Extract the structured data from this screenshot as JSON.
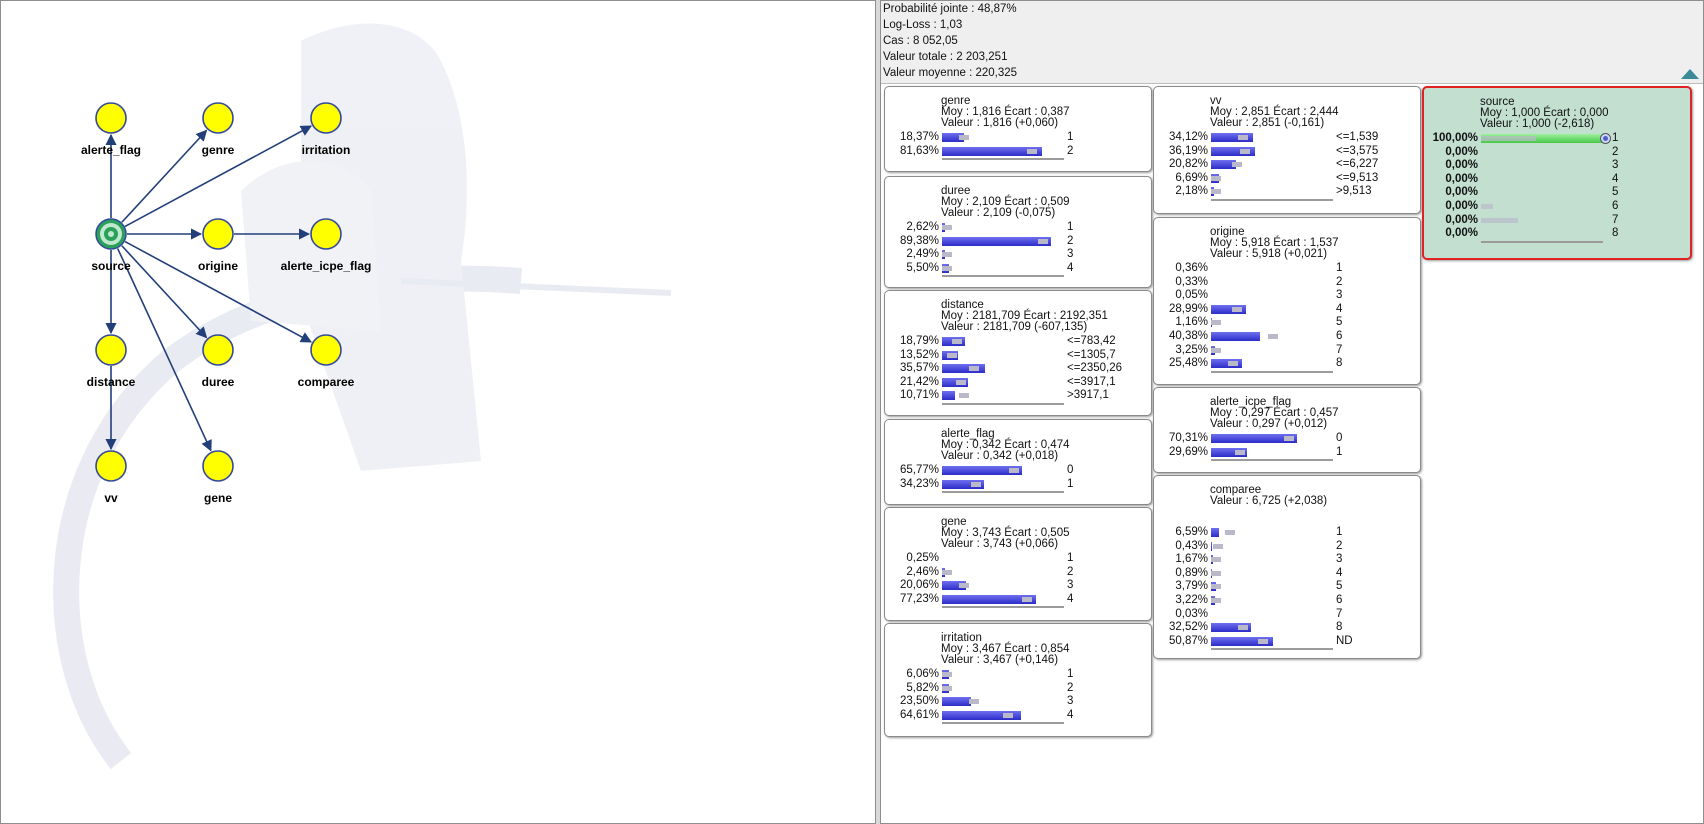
{
  "graph": {
    "nodes": [
      {
        "id": "alerte_flag",
        "label": "alerte_flag"
      },
      {
        "id": "genre",
        "label": "genre"
      },
      {
        "id": "irritation",
        "label": "irritation"
      },
      {
        "id": "source",
        "label": "source"
      },
      {
        "id": "origine",
        "label": "origine"
      },
      {
        "id": "alerte_icpe_flag",
        "label": "alerte_icpe_flag"
      },
      {
        "id": "distance",
        "label": "distance"
      },
      {
        "id": "duree",
        "label": "duree"
      },
      {
        "id": "comparee",
        "label": "comparee"
      },
      {
        "id": "vv",
        "label": "vv"
      },
      {
        "id": "gene",
        "label": "gene"
      }
    ],
    "edges": [
      [
        "source",
        "alerte_flag"
      ],
      [
        "source",
        "genre"
      ],
      [
        "source",
        "irritation"
      ],
      [
        "source",
        "origine"
      ],
      [
        "origine",
        "alerte_icpe_flag"
      ],
      [
        "source",
        "distance"
      ],
      [
        "source",
        "duree"
      ],
      [
        "source",
        "comparee"
      ],
      [
        "distance",
        "vv"
      ],
      [
        "source",
        "gene"
      ]
    ],
    "colors": {
      "node_fill": "#ffff00",
      "node_stroke": "#334a9a",
      "target_fill": "#2aa05a",
      "edge": "#223f7a"
    }
  },
  "stats": {
    "joint": "Probabilité jointe : 48,87%",
    "logloss": "Log-Loss : 1,03",
    "cases": "Cas : 8 052,05",
    "total": "Valeur totale : 2 203,251",
    "mean": "Valeur moyenne : 220,325"
  },
  "cards": [
    {
      "id": "genre",
      "title": "genre",
      "stats": "Moy : 1,816 Écart : 0,387",
      "value": "Valeur : 1,816 (+0,060)",
      "rows": [
        {
          "pct": "18,37%",
          "p": 18.37,
          "label": "1",
          "ghost": 22
        },
        {
          "pct": "81,63%",
          "p": 81.63,
          "label": "2",
          "ghost": 78
        }
      ]
    },
    {
      "id": "duree",
      "title": "duree",
      "stats": "Moy : 2,109 Écart : 0,509",
      "value": "Valeur : 2,109 (-0,075)",
      "rows": [
        {
          "pct": "2,62%",
          "p": 2.62,
          "label": "1",
          "ghost": 3
        },
        {
          "pct": "89,38%",
          "p": 89.38,
          "label": "2",
          "ghost": 87
        },
        {
          "pct": "2,49%",
          "p": 2.49,
          "label": "3",
          "ghost": 3
        },
        {
          "pct": "5,50%",
          "p": 5.5,
          "label": "4",
          "ghost": 7
        }
      ]
    },
    {
      "id": "distance",
      "title": "distance",
      "stats": "Moy : 2181,709 Écart : 2192,351",
      "value": "Valeur : 2181,709 (-607,135)",
      "rows": [
        {
          "pct": "18,79%",
          "p": 18.79,
          "label": "<=783,42",
          "ghost": 16
        },
        {
          "pct": "13,52%",
          "p": 13.52,
          "label": "<=1305,7",
          "ghost": 12
        },
        {
          "pct": "35,57%",
          "p": 35.57,
          "label": "<=2350,26",
          "ghost": 30
        },
        {
          "pct": "21,42%",
          "p": 21.42,
          "label": "<=3917,1",
          "ghost": 20
        },
        {
          "pct": "10,71%",
          "p": 10.71,
          "label": ">3917,1",
          "ghost": 22
        }
      ]
    },
    {
      "id": "alerte_flag",
      "title": "alerte_flag",
      "stats": "Moy : 0,342 Écart : 0,474",
      "value": "Valeur : 0,342 (+0,018)",
      "rows": [
        {
          "pct": "65,77%",
          "p": 65.77,
          "label": "0",
          "ghost": 63
        },
        {
          "pct": "34,23%",
          "p": 34.23,
          "label": "1",
          "ghost": 32
        }
      ]
    },
    {
      "id": "gene",
      "title": "gene",
      "stats": "Moy : 3,743 Écart : 0,505",
      "value": "Valeur : 3,743 (+0,066)",
      "rows": [
        {
          "pct": "0,25%",
          "p": 0.25,
          "label": "1",
          "ghost": 0
        },
        {
          "pct": "2,46%",
          "p": 2.46,
          "label": "2",
          "ghost": 2
        },
        {
          "pct": "20,06%",
          "p": 20.06,
          "label": "3",
          "ghost": 22
        },
        {
          "pct": "77,23%",
          "p": 77.23,
          "label": "4",
          "ghost": 74
        }
      ]
    },
    {
      "id": "irritation",
      "title": "irritation",
      "stats": "Moy : 3,467 Écart : 0,854",
      "value": "Valeur : 3,467 (+0,146)",
      "rows": [
        {
          "pct": "6,06%",
          "p": 6.06,
          "label": "1",
          "ghost": 5
        },
        {
          "pct": "5,82%",
          "p": 5.82,
          "label": "2",
          "ghost": 6
        },
        {
          "pct": "23,50%",
          "p": 23.5,
          "label": "3",
          "ghost": 30
        },
        {
          "pct": "64,61%",
          "p": 64.61,
          "label": "4",
          "ghost": 58
        }
      ]
    },
    {
      "id": "vv",
      "title": "vv",
      "stats": "Moy : 2,851 Écart : 2,444",
      "value": "Valeur : 2,851 (-0,161)",
      "rows": [
        {
          "pct": "34,12%",
          "p": 34.12,
          "label": "<=1,539",
          "ghost": 30
        },
        {
          "pct": "36,19%",
          "p": 36.19,
          "label": "<=3,575",
          "ghost": 32
        },
        {
          "pct": "20,82%",
          "p": 20.82,
          "label": "<=6,227",
          "ghost": 25
        },
        {
          "pct": "6,69%",
          "p": 6.69,
          "label": "<=9,513",
          "ghost": 7
        },
        {
          "pct": "2,18%",
          "p": 2.18,
          "label": ">9,513",
          "ghost": 2
        }
      ]
    },
    {
      "id": "origine",
      "title": "origine",
      "stats": "Moy : 5,918 Écart : 1,537",
      "value": "Valeur : 5,918 (+0,021)",
      "rows": [
        {
          "pct": "0,36%",
          "p": 0.36,
          "label": "1",
          "ghost": 0
        },
        {
          "pct": "0,33%",
          "p": 0.33,
          "label": "2",
          "ghost": 0
        },
        {
          "pct": "0,05%",
          "p": 0.05,
          "label": "3",
          "ghost": 0
        },
        {
          "pct": "28,99%",
          "p": 28.99,
          "label": "4",
          "ghost": 25
        },
        {
          "pct": "1,16%",
          "p": 1.16,
          "label": "5",
          "ghost": 1
        },
        {
          "pct": "40,38%",
          "p": 40.38,
          "label": "6",
          "ghost": 55
        },
        {
          "pct": "3,25%",
          "p": 3.25,
          "label": "7",
          "ghost": 3
        },
        {
          "pct": "25,48%",
          "p": 25.48,
          "label": "8",
          "ghost": 22
        }
      ]
    },
    {
      "id": "alerte_icpe_flag",
      "title": "alerte_icpe_flag",
      "stats": "Moy : 0,297 Écart : 0,457",
      "value": "Valeur : 0,297 (+0,012)",
      "rows": [
        {
          "pct": "70,31%",
          "p": 70.31,
          "label": "0",
          "ghost": 68
        },
        {
          "pct": "29,69%",
          "p": 29.69,
          "label": "1",
          "ghost": 28
        }
      ]
    },
    {
      "id": "comparee",
      "title": "comparee",
      "stats": "",
      "value": "Valeur : 6,725 (+2,038)",
      "rows": [
        {
          "pct": "6,59%",
          "p": 6.59,
          "label": "1",
          "ghost": 20
        },
        {
          "pct": "0,43%",
          "p": 0.43,
          "label": "2",
          "ghost": 10
        },
        {
          "pct": "1,67%",
          "p": 1.67,
          "label": "3",
          "ghost": 4
        },
        {
          "pct": "0,89%",
          "p": 0.89,
          "label": "4",
          "ghost": 2
        },
        {
          "pct": "3,79%",
          "p": 3.79,
          "label": "5",
          "ghost": 3
        },
        {
          "pct": "3,22%",
          "p": 3.22,
          "label": "6",
          "ghost": 3
        },
        {
          "pct": "0,03%",
          "p": 0.03,
          "label": "7",
          "ghost": 0
        },
        {
          "pct": "32,52%",
          "p": 32.52,
          "label": "8",
          "ghost": 30
        },
        {
          "pct": "50,87%",
          "p": 50.87,
          "label": "ND",
          "ghost": 47
        }
      ]
    },
    {
      "id": "source",
      "title": "source",
      "stats": "Moy : 1,000 Écart : 0,000",
      "value": "Valeur : 1,000 (-2,618)",
      "target": true,
      "rows": [
        {
          "pct": "100,00%",
          "p": 100,
          "label": "1",
          "ghost": 45,
          "radio": true
        },
        {
          "pct": "0,00%",
          "p": 0,
          "label": "2",
          "ghost": 0
        },
        {
          "pct": "0,00%",
          "p": 0,
          "label": "3",
          "ghost": 0
        },
        {
          "pct": "0,00%",
          "p": 0,
          "label": "4",
          "ghost": 0
        },
        {
          "pct": "0,00%",
          "p": 0,
          "label": "5",
          "ghost": 0
        },
        {
          "pct": "0,00%",
          "p": 0,
          "label": "6",
          "ghost": 10
        },
        {
          "pct": "0,00%",
          "p": 0,
          "label": "7",
          "ghost": 30
        },
        {
          "pct": "0,00%",
          "p": 0,
          "label": "8",
          "ghost": 0
        }
      ]
    }
  ]
}
